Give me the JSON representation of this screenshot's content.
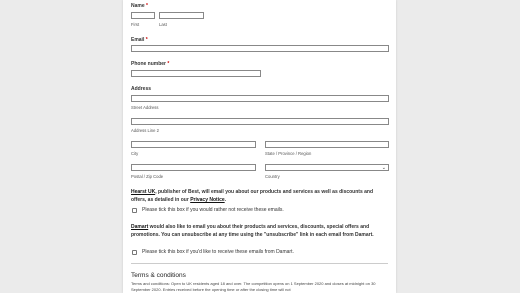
{
  "name": {
    "label": "Name",
    "required": "*",
    "first": "First",
    "last": "Last"
  },
  "email": {
    "label": "Email",
    "required": "*"
  },
  "phone": {
    "label": "Phone number",
    "required": "*"
  },
  "address": {
    "label": "Address",
    "street": "Street Address",
    "line2": "Address Line 2",
    "city": "City",
    "state": "State / Province / Region",
    "zip": "Postal / Zip Code",
    "country": "Country"
  },
  "consent1": {
    "brand": "Hearst UK",
    "text_a": ", publisher of Best, will email you about our products and services as well as discounts and offers, as detailed in our ",
    "link": "Privacy Notice",
    "text_b": ".",
    "checkbox_label": "Please tick this box if you would rather not receive these emails."
  },
  "consent2": {
    "brand": "Damart",
    "text": " would also like to email you about their products and services, discounts, special offers and promotions. You can unsubscribe at any time using the \"unsubscribe\" link in each email from Damart.",
    "checkbox_label": "Please tick this box if you'd like to receive these emails from Damart."
  },
  "terms": {
    "title": "Terms & conditions",
    "text": "Terms and conditions: Open to UK residents aged 18 and over. The competition opens on 1 September 2020 and closes at midnight on 30 September 2020. Entries received before the opening time or after the closing time will not"
  }
}
